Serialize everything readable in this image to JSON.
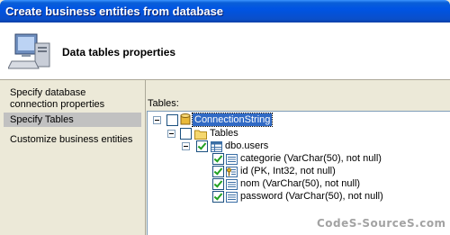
{
  "window": {
    "title": "Create business entities from database"
  },
  "header": {
    "title": "Data tables properties",
    "icon": "computer-icon"
  },
  "nav": {
    "items": [
      {
        "label_line1": "Specify database",
        "label_line2": "connection properties",
        "selected": false
      },
      {
        "label": "Specify Tables",
        "selected": true
      },
      {
        "label": "Customize business entities",
        "selected": false
      }
    ]
  },
  "main": {
    "tables_label": "Tables:",
    "tree": {
      "root": {
        "label": "ConnectionString",
        "checked": false,
        "icon": "database-icon"
      },
      "folder": {
        "label": "Tables",
        "checked": false,
        "icon": "folder-icon"
      },
      "table": {
        "label": "dbo.users",
        "checked": true,
        "icon": "table-icon"
      },
      "columns": [
        {
          "label": "categorie (VarChar(50), not null)",
          "checked": true,
          "icon": "column-icon"
        },
        {
          "label": "id (PK, Int32, not null)",
          "checked": true,
          "icon": "key-column-icon"
        },
        {
          "label": "nom (VarChar(50), not null)",
          "checked": true,
          "icon": "column-icon"
        },
        {
          "label": "password (VarChar(50), not null)",
          "checked": true,
          "icon": "column-icon"
        }
      ]
    }
  },
  "watermark": "CodeS-SourceS.com",
  "colors": {
    "titlebar": "#0054e3",
    "selection": "#316ac5",
    "check": "#21a121",
    "dialog_bg": "#ece9d8"
  }
}
